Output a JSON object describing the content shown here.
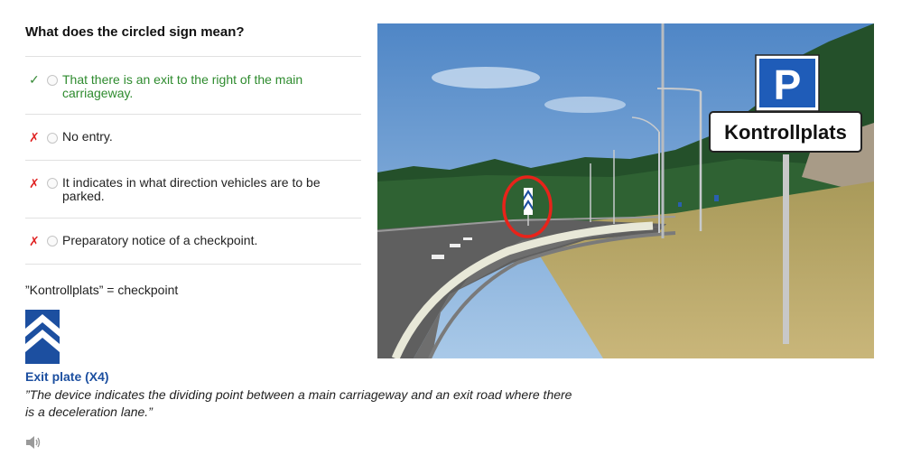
{
  "question": "What does the circled sign mean?",
  "answers": [
    {
      "status": "correct",
      "mark": "✓",
      "text": "That there is an exit to the right of the main carriageway."
    },
    {
      "status": "wrong",
      "mark": "✗",
      "text": "No entry."
    },
    {
      "status": "wrong",
      "mark": "✗",
      "text": "It indicates in what direction vehicles are to be parked."
    },
    {
      "status": "wrong",
      "mark": "✗",
      "text": "Preparatory notice of a checkpoint."
    }
  ],
  "note": "”Kontrollplats” = checkpoint",
  "plate": {
    "title": "Exit plate (X4)",
    "description": "”The device indicates the dividing point between a main carriageway and an exit road where there is a deceleration lane.”"
  },
  "photo": {
    "parking_sign_letter": "P",
    "sign_text": "Kontrollplats"
  },
  "icons": {
    "correct_mark": "check-icon",
    "wrong_mark": "cross-icon",
    "exit_plate": "exit-plate-icon",
    "audio": "speaker-icon"
  },
  "colors": {
    "correct": "#2e8b2e",
    "wrong": "#e02424",
    "plate_blue": "#1c4fa0",
    "highlight_circle": "#e8231a"
  }
}
